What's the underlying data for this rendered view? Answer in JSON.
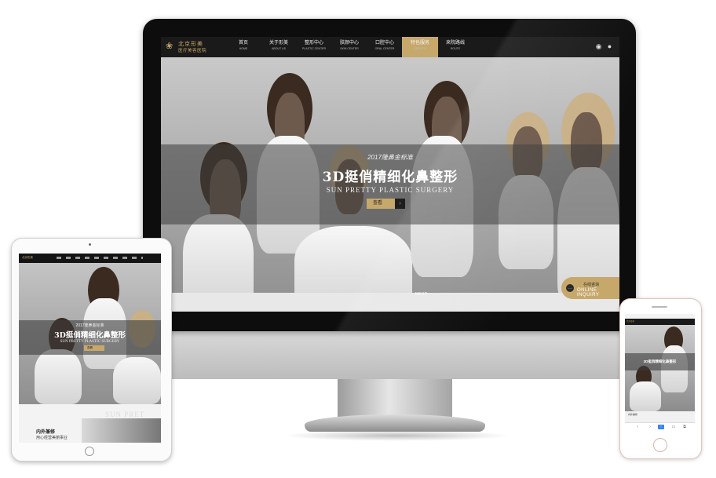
{
  "brand": {
    "name_zh": "北京形美",
    "name_sub_zh": "医疗美容医院",
    "accent_color": "#c7a86b"
  },
  "nav": {
    "items": [
      {
        "zh": "首页",
        "en": "HOME"
      },
      {
        "zh": "关于形美",
        "en": "ABOUT US"
      },
      {
        "zh": "整形中心",
        "en": "PLASTIC CENTER"
      },
      {
        "zh": "肤颜中心",
        "en": "SKIN CENTER"
      },
      {
        "zh": "口腔中心",
        "en": "ORAL CENTER"
      },
      {
        "zh": "特色服务",
        "en": "SERVICE"
      },
      {
        "zh": "来院路线",
        "en": "ROUTE"
      }
    ],
    "active_index": 5,
    "icons": [
      "weibo-icon",
      "wechat-icon"
    ]
  },
  "hero": {
    "subtitle": "2017隆鼻金标准",
    "title": "3D挺俏精细化鼻整形",
    "title_en": "SUN PRETTY PLASTIC SURGERY",
    "button_label": "查看",
    "next_label": "NEXT"
  },
  "inquiry": {
    "zh": "在线咨询",
    "en": "ONLINE INQUIRY"
  },
  "tablet": {
    "title": "3D挺俏精细化鼻整形",
    "subtitle": "2017隆鼻金标准",
    "title_en": "SUN PRETTY PLASTIC SURGERY",
    "button_label": "查看",
    "bg_text": "SUN PRET",
    "section_title": "内外兼修",
    "section_sub": "用心经营美丽事业"
  },
  "phone": {
    "title": "3D挺俏精细化鼻整形",
    "lower_text": "内外兼修"
  }
}
